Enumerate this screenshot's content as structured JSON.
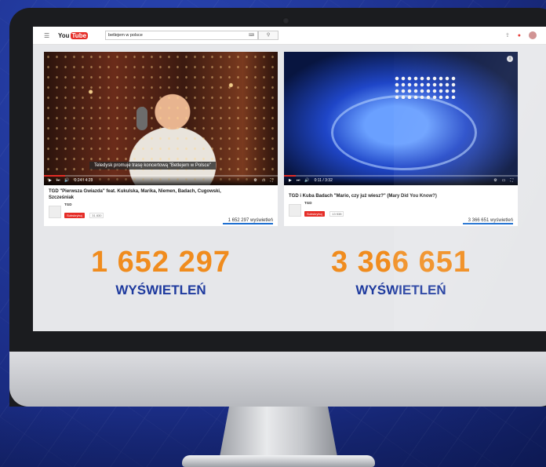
{
  "youtube": {
    "logo_you": "You",
    "logo_tube": "Tube",
    "search_query": "betlejem w polsce",
    "search_keyboard": "⌨"
  },
  "videos": [
    {
      "caption": "Teledysk promuje trasę koncertową \"Betlejem w Polsce\"",
      "time": "0:24 / 4:23",
      "progress_fraction": 0.09,
      "title": "TGD \"Pierwsza Gwiazda\" feat. Kukulska, Marika, Niemen, Badach, Cugowski, Szcześniak",
      "channel": "TGD",
      "subscribe_label": "Subskrybuj",
      "sub_count": "31 830",
      "views_text": "1 652 297 wyświetleń",
      "big_number": "1 652 297",
      "big_label": "WYŚWIETLEŃ"
    },
    {
      "caption": "",
      "time": "0:11 / 3:32",
      "progress_fraction": 0.05,
      "title": "TGD i Kuba Badach \"Mario, czy już wiesz?\" (Mary Did You Know?)",
      "channel": "TGD",
      "subscribe_label": "Subskrybuj",
      "sub_count": "13 538",
      "views_text": "3 366 651 wyświetleń",
      "big_number": "3 366 651",
      "big_label": "WYŚWIETLEŃ"
    }
  ],
  "colors": {
    "accent_orange": "#f08c1e",
    "label_blue": "#1e3a9e",
    "youtube_red": "#e52d27"
  }
}
